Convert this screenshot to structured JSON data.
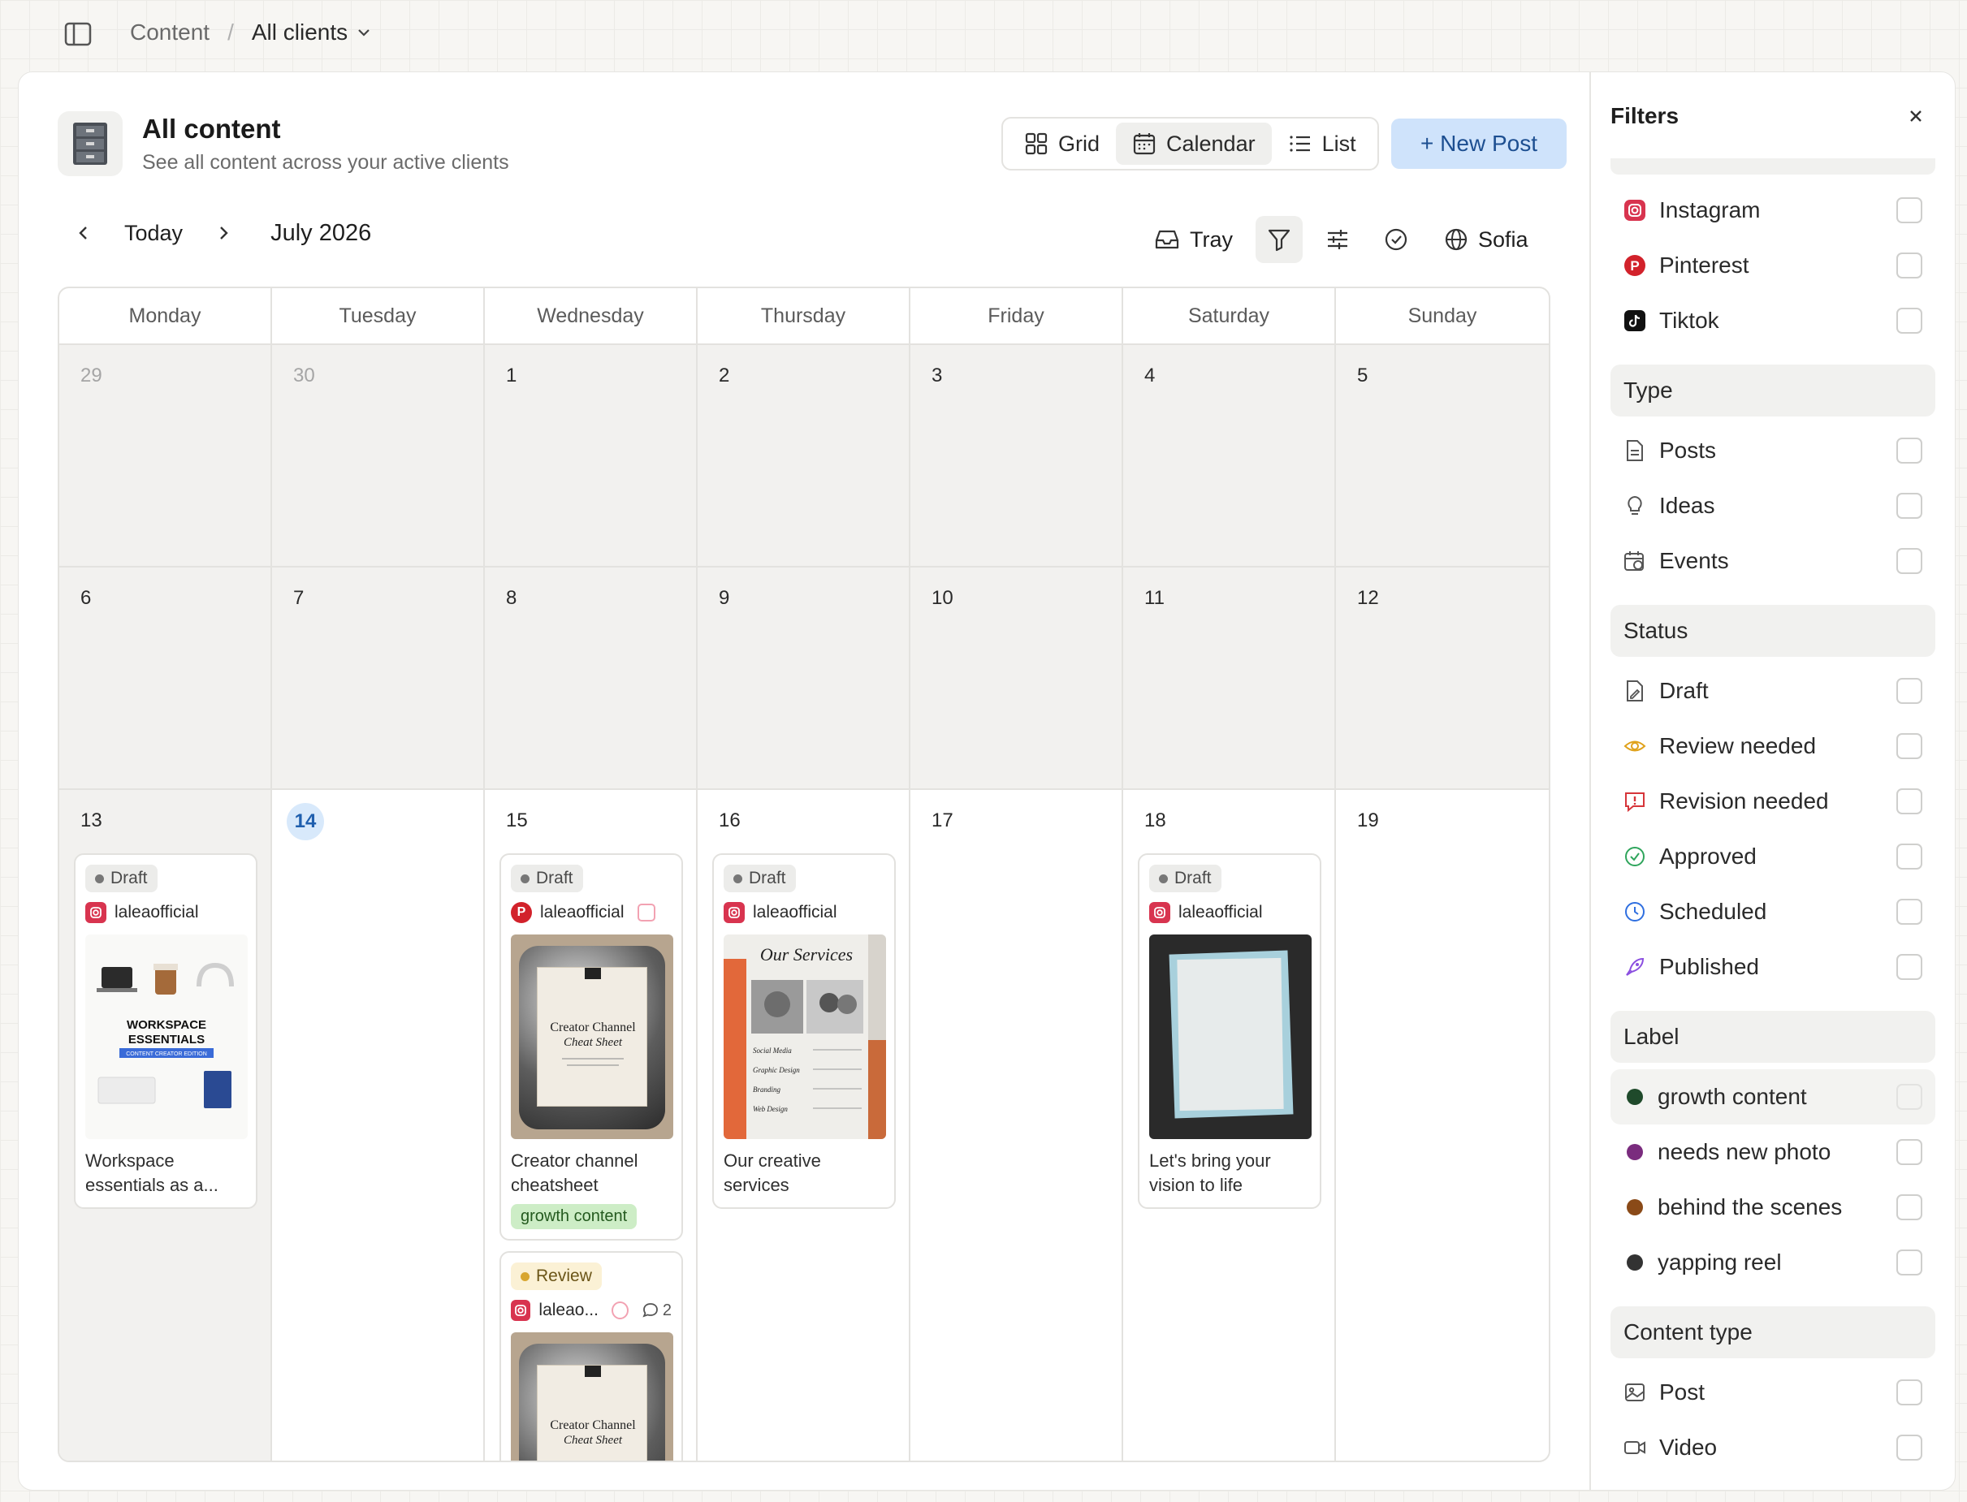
{
  "breadcrumb": {
    "root": "Content",
    "separator": "/",
    "current": "All clients"
  },
  "page": {
    "title": "All content",
    "subtitle": "See all content across your active clients"
  },
  "views": {
    "grid": "Grid",
    "calendar": "Calendar",
    "list": "List",
    "active": "Calendar"
  },
  "new_post": "+ New Post",
  "calendar": {
    "today_label": "Today",
    "month_label": "July 2026",
    "weekdays": [
      "Monday",
      "Tuesday",
      "Wednesday",
      "Thursday",
      "Friday",
      "Saturday",
      "Sunday"
    ],
    "weeks": [
      [
        "29",
        "30",
        "1",
        "2",
        "3",
        "4",
        "5"
      ],
      [
        "6",
        "7",
        "8",
        "9",
        "10",
        "11",
        "12"
      ],
      [
        "13",
        "14",
        "15",
        "16",
        "17",
        "18",
        "19"
      ]
    ],
    "today_date": "14"
  },
  "toolbar": {
    "tray": "Tray",
    "user": "Sofia"
  },
  "posts": {
    "mon13": {
      "status": "Draft",
      "account": "laleaofficial",
      "title": "Workspace essentials as a...",
      "thumb_text_1": "WORKSPACE",
      "thumb_text_2": "ESSENTIALS",
      "thumb_text_3": "CONTENT CREATOR EDITION"
    },
    "wed15a": {
      "status": "Draft",
      "account": "laleaofficial",
      "title": "Creator channel cheatsheet",
      "label": "growth content",
      "thumb_text_1": "Creator Channel",
      "thumb_text_2": "Cheat Sheet"
    },
    "wed15b": {
      "status": "Review",
      "account": "laleao...",
      "comments": "2",
      "thumb_text_1": "Creator Channel",
      "thumb_text_2": "Cheat Sheet"
    },
    "thu16": {
      "status": "Draft",
      "account": "laleaofficial",
      "title": "Our creative services",
      "thumb_text_1": "Our Services",
      "thumb_items": [
        "Social Media",
        "Graphic Design",
        "Branding",
        "Web Design"
      ]
    },
    "sat18": {
      "status": "Draft",
      "account": "laleaofficial",
      "title": "Let's bring your vision to life"
    }
  },
  "filters": {
    "title": "Filters",
    "platforms": [
      "Instagram",
      "Pinterest",
      "Tiktok"
    ],
    "type_head": "Type",
    "types": [
      "Posts",
      "Ideas",
      "Events"
    ],
    "status_head": "Status",
    "statuses": [
      "Draft",
      "Review needed",
      "Revision needed",
      "Approved",
      "Scheduled",
      "Published"
    ],
    "label_head": "Label",
    "labels": [
      "growth content",
      "needs new photo",
      "behind the scenes",
      "yapping reel"
    ],
    "content_type_head": "Content type",
    "content_types": [
      "Post",
      "Video"
    ]
  },
  "colors": {
    "accent": "#cfe3fb",
    "today": "#d8e9fb",
    "label_growth": "#1f4a2b",
    "label_photo": "#7a2c7e",
    "label_bts": "#8a4a18",
    "label_yap": "#333333"
  },
  "icons": {
    "platforms": [
      "instagram-icon",
      "pinterest-icon",
      "tiktok-icon"
    ],
    "types": [
      "document-icon",
      "lightbulb-icon",
      "calendar-clock-icon"
    ],
    "statuses": [
      "draft-doc-icon",
      "eye-icon",
      "alert-icon",
      "check-circle-icon",
      "clock-icon",
      "rocket-icon"
    ]
  }
}
